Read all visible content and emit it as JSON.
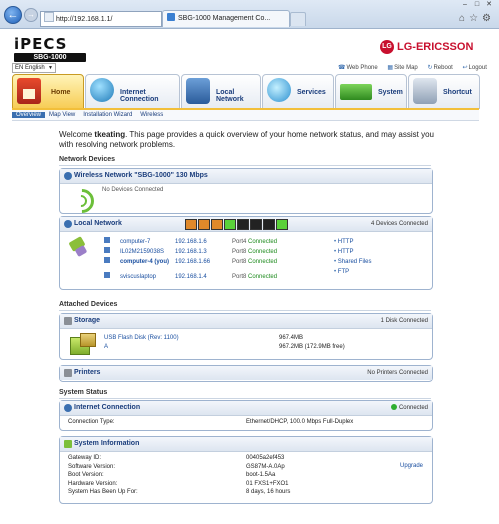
{
  "browser": {
    "address": "http://192.168.1.1/",
    "tab_title": "SBG-1000 Management Co..."
  },
  "header": {
    "brand": "iPECS",
    "model": "SBG-1000",
    "vendor": "LG-ERICSSON",
    "vendor_mark": "LG",
    "language": "EN English",
    "links": {
      "web_phone": "Web Phone",
      "site_map": "Site Map",
      "reboot": "Reboot",
      "logout": "Logout"
    }
  },
  "tabs": {
    "home": "Home",
    "internet": "Internet Connection",
    "local": "Local Network",
    "services": "Services",
    "system": "System",
    "shortcut": "Shortcut"
  },
  "subtabs": {
    "overview": "Overview",
    "map_view": "Map View",
    "installation_wizard": "Installation Wizard",
    "wireless": "Wireless"
  },
  "welcome": {
    "prefix": "Welcome ",
    "user": "tkeating",
    "text": ". This page provides a quick overview of your home network status, and may assist you with resolving network problems."
  },
  "network_devices": {
    "heading": "Network Devices",
    "wireless": {
      "title": "Wireless Network \"SBG-1000\" 130 Mbps",
      "status": "No Devices Connected"
    },
    "local": {
      "title": "Local Network",
      "count": "4 Devices Connected",
      "devices": [
        {
          "name": "computer-7",
          "ip": "192.168.1.6",
          "port": "Port4",
          "status": "Connected"
        },
        {
          "name": "IL02M2159038S",
          "ip": "192.168.1.3",
          "port": "Port8",
          "status": "Connected"
        },
        {
          "name": "computer-4 (you)",
          "ip": "192.168.1.66",
          "port": "Port8",
          "status": "Connected"
        },
        {
          "name": "sviscuslaptop",
          "ip": "192.168.1.4",
          "port": "Port8",
          "status": "Connected"
        }
      ],
      "services": [
        "HTTP",
        "HTTP",
        "Shared Files",
        "FTP"
      ]
    }
  },
  "attached_devices": {
    "heading": "Attached Devices",
    "storage": {
      "title": "Storage",
      "count": "1 Disk Connected",
      "disk_name": "USB Flash Disk (Rev: 1100)",
      "partition": "A",
      "size": "967.4MB",
      "free": "967.2MB (172.9MB free)"
    },
    "printers": {
      "title": "Printers",
      "count": "No Printers Connected"
    }
  },
  "system_status": {
    "heading": "System Status",
    "internet": {
      "title": "Internet Connection",
      "status": "Connected",
      "type_label": "Connection Type:",
      "type_value": "Ethernet/DHCP, 100.0 Mbps Full-Duplex"
    },
    "info": {
      "title": "System Information",
      "upgrade": "Upgrade",
      "rows": [
        {
          "label": "Gateway ID:",
          "value": "00405a2ef453"
        },
        {
          "label": "Software Version:",
          "value": "GS87M-A.0Ap"
        },
        {
          "label": "Boot Version:",
          "value": "boot-1.5Aa"
        },
        {
          "label": "Hardware Version:",
          "value": "01 FXS1+FXO1"
        },
        {
          "label": "System Has Been Up For:",
          "value": "8 days, 16 hours"
        }
      ]
    }
  },
  "colors": {
    "accent_blue": "#1a3d7c",
    "home_tab": "#f6c84a",
    "connected_green": "#1d8a1d",
    "vendor_red": "#c8102e"
  }
}
